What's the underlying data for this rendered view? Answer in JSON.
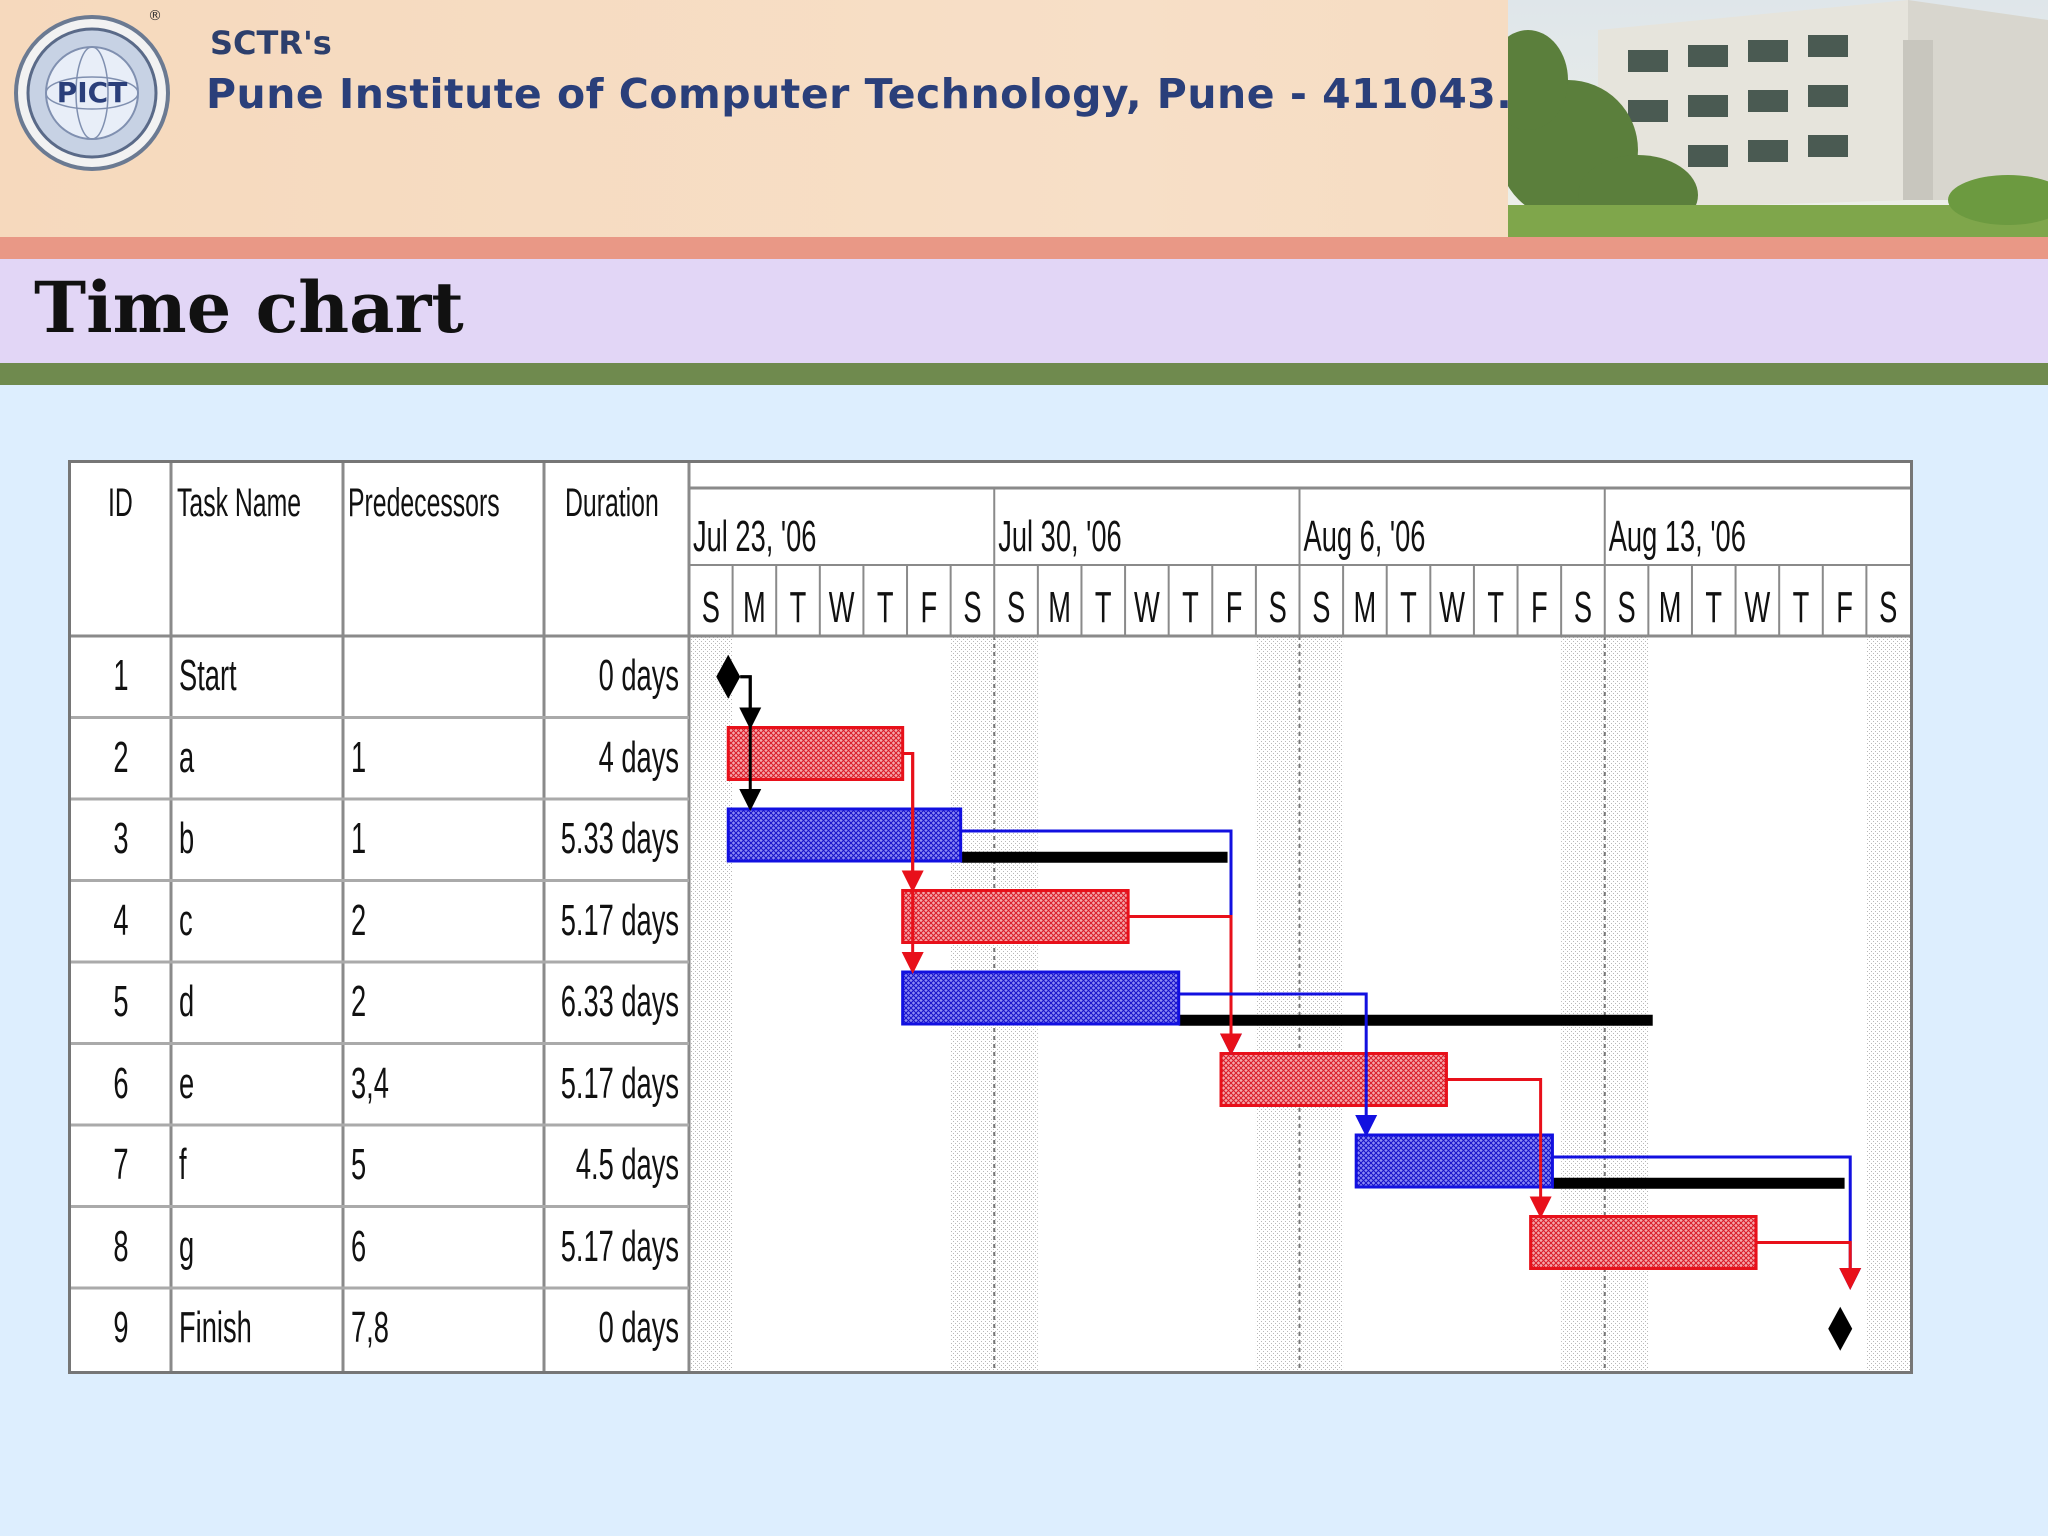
{
  "banner": {
    "org_short": "SCTR's",
    "institute": "Pune Institute of Computer Technology, Pune - 411043.",
    "logo_text": "PICT",
    "registered_mark": "®",
    "colors": {
      "banner_bg": "#f6d9bd",
      "title_text": "#2a3f7a"
    }
  },
  "slide": {
    "title": "Time chart",
    "colors": {
      "top_rule": "#e99886",
      "title_band": "#e2d6f6",
      "bottom_rule": "#6f8a4e",
      "background": "#ddeefe"
    }
  },
  "table": {
    "headers": {
      "id": "ID",
      "task_name": "Task Name",
      "predecessors": "Predecessors",
      "duration": "Duration"
    },
    "rows": [
      {
        "id": "1",
        "name": "Start",
        "pred": "",
        "duration": "0 days"
      },
      {
        "id": "2",
        "name": "a",
        "pred": "1",
        "duration": "4 days"
      },
      {
        "id": "3",
        "name": "b",
        "pred": "1",
        "duration": "5.33 days"
      },
      {
        "id": "4",
        "name": "c",
        "pred": "2",
        "duration": "5.17 days"
      },
      {
        "id": "5",
        "name": "d",
        "pred": "2",
        "duration": "6.33 days"
      },
      {
        "id": "6",
        "name": "e",
        "pred": "3,4",
        "duration": "5.17 days"
      },
      {
        "id": "7",
        "name": "f",
        "pred": "5",
        "duration": "4.5 days"
      },
      {
        "id": "8",
        "name": "g",
        "pred": "6",
        "duration": "5.17 days"
      },
      {
        "id": "9",
        "name": "Finish",
        "pred": "7,8",
        "duration": "0 days"
      }
    ]
  },
  "chart_data": {
    "type": "gantt",
    "weeks": [
      "Jul 23, '06",
      "Jul 30, '06",
      "Aug 6, '06",
      "Aug 13, '06"
    ],
    "day_letters": [
      "S",
      "M",
      "T",
      "W",
      "T",
      "F",
      "S"
    ],
    "start_day_offset": 0,
    "total_days": 28,
    "weekend_shading": true,
    "tasks": [
      {
        "id": 1,
        "name": "Start",
        "type": "milestone",
        "start": 0.9
      },
      {
        "id": 2,
        "name": "a",
        "type": "bar",
        "start": 0.9,
        "duration": 4,
        "color": "red",
        "slack_end": null
      },
      {
        "id": 3,
        "name": "b",
        "type": "bar",
        "start": 0.9,
        "duration": 5.33,
        "color": "blue",
        "slack_end": 12.35
      },
      {
        "id": 4,
        "name": "c",
        "type": "bar",
        "start": 4.9,
        "duration": 5.17,
        "color": "red",
        "slack_end": null
      },
      {
        "id": 5,
        "name": "d",
        "type": "bar",
        "start": 4.9,
        "duration": 6.33,
        "color": "blue",
        "slack_end": 22.1
      },
      {
        "id": 6,
        "name": "e",
        "type": "bar",
        "start": 12.2,
        "duration": 5.17,
        "color": "red",
        "slack_end": null
      },
      {
        "id": 7,
        "name": "f",
        "type": "bar",
        "start": 15.3,
        "duration": 4.5,
        "color": "blue",
        "slack_end": 26.5
      },
      {
        "id": 8,
        "name": "g",
        "type": "bar",
        "start": 19.3,
        "duration": 5.17,
        "color": "red",
        "slack_end": null
      },
      {
        "id": 9,
        "name": "Finish",
        "type": "milestone",
        "start": 26.4
      }
    ],
    "links": [
      {
        "from": 1,
        "to": 2,
        "color": "black"
      },
      {
        "from": 1,
        "to": 3,
        "color": "black"
      },
      {
        "from": 2,
        "to": 4,
        "color": "red"
      },
      {
        "from": 2,
        "to": 5,
        "color": "red"
      },
      {
        "from": 3,
        "to": 6,
        "color": "blue"
      },
      {
        "from": 4,
        "to": 6,
        "color": "red"
      },
      {
        "from": 5,
        "to": 7,
        "color": "blue"
      },
      {
        "from": 6,
        "to": 8,
        "color": "red"
      },
      {
        "from": 7,
        "to": 9,
        "color": "blue"
      },
      {
        "from": 8,
        "to": 9,
        "color": "red"
      }
    ],
    "colors": {
      "red": "#e8101a",
      "blue": "#1210e0",
      "black": "#000000",
      "red_fill": "#f08a8e",
      "blue_fill": "#6a68ee"
    }
  }
}
